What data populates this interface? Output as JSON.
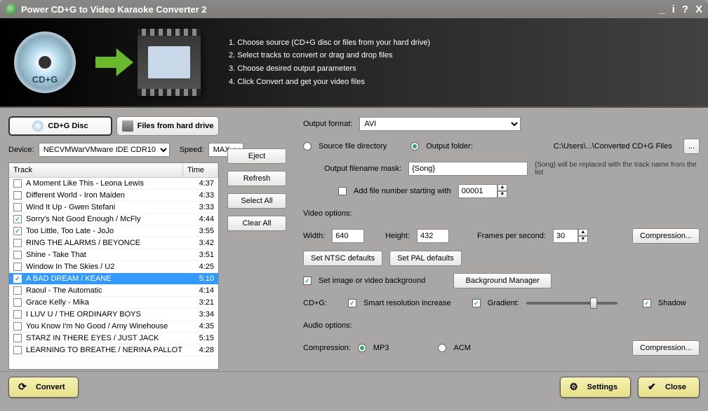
{
  "app": {
    "title": "Power CD+G to Video Karaoke Converter 2"
  },
  "banner": {
    "disc_label": "CD+G",
    "steps": [
      "1. Choose source (CD+G disc or files from your hard drive)",
      "2. Select tracks to convert or drag and drop files",
      "3. Choose desired output parameters",
      "4. Click Convert and get your video files"
    ]
  },
  "source": {
    "cdg_btn": "CD+G Disc",
    "files_btn": "Files from hard drive",
    "device_label": "Device:",
    "device_value": "NECVMWarVMware IDE CDR10",
    "speed_label": "Speed:",
    "speed_value": "MAX"
  },
  "track_header": {
    "track": "Track",
    "time": "Time"
  },
  "tracks": [
    {
      "name": "A Moment Like This - Leona Lewis",
      "time": "4:37",
      "checked": false,
      "selected": false
    },
    {
      "name": "Different World - Iron Maiden",
      "time": "4:33",
      "checked": false,
      "selected": false
    },
    {
      "name": "Wind It Up - Gwen Stefani",
      "time": "3:33",
      "checked": false,
      "selected": false
    },
    {
      "name": "Sorry's Not Good Enough / McFly",
      "time": "4:44",
      "checked": true,
      "selected": false
    },
    {
      "name": "Too Little, Too Late - JoJo",
      "time": "3:55",
      "checked": true,
      "selected": false
    },
    {
      "name": "RING THE ALARMS / BEYONCE",
      "time": "3:42",
      "checked": false,
      "selected": false
    },
    {
      "name": "Shine - Take That",
      "time": "3:51",
      "checked": false,
      "selected": false
    },
    {
      "name": "Window In The Skies / U2",
      "time": "4:25",
      "checked": false,
      "selected": false
    },
    {
      "name": "A BAD DREAM / KEANE",
      "time": "5:10",
      "checked": true,
      "selected": true
    },
    {
      "name": "Raoul - The Automatic",
      "time": "4:14",
      "checked": false,
      "selected": false
    },
    {
      "name": "Grace Kelly - Mika",
      "time": "3:21",
      "checked": false,
      "selected": false
    },
    {
      "name": "I LUV U / THE ORDINARY BOYS",
      "time": "3:34",
      "checked": false,
      "selected": false
    },
    {
      "name": "You Know I'm No Good / Amy Winehouse",
      "time": "4:35",
      "checked": false,
      "selected": false
    },
    {
      "name": "STARZ IN THERE EYES / JUST JACK",
      "time": "5:15",
      "checked": false,
      "selected": false
    },
    {
      "name": "LEARNING TO BREATHE / NERINA PALLOT",
      "time": "4:28",
      "checked": false,
      "selected": false
    }
  ],
  "mid_buttons": {
    "eject": "Eject",
    "refresh": "Refresh",
    "select_all": "Select All",
    "clear_all": "Clear All"
  },
  "output": {
    "format_label": "Output format:",
    "format_value": "AVI",
    "src_dir_radio": "Source file directory",
    "out_folder_radio": "Output folder:",
    "out_folder_path": "C:\\Users\\...\\Converted CD+G Files",
    "browse": "...",
    "mask_label": "Output filename mask:",
    "mask_value": "{Song}",
    "mask_hint": "{Song} will be replaced with the track name from the list",
    "add_num_label": "Add file number starting with",
    "add_num_value": "00001"
  },
  "video": {
    "section": "Video options:",
    "width_label": "Width:",
    "width": "640",
    "height_label": "Height:",
    "height": "432",
    "fps_label": "Frames per second:",
    "fps": "30",
    "compression": "Compression...",
    "ntsc": "Set NTSC defaults",
    "pal": "Set PAL defaults",
    "set_bg_label": "Set image or video background",
    "bg_manager": "Background Manager",
    "cdg_label": "CD+G:",
    "smart": "Smart resolution increase",
    "gradient": "Gradient:",
    "shadow": "Shadow"
  },
  "audio": {
    "section": "Audio options:",
    "compression_label": "Compression:",
    "mp3": "MP3",
    "acm": "ACM",
    "compression_btn": "Compression..."
  },
  "footer": {
    "convert": "Convert",
    "settings": "Settings",
    "close": "Close"
  }
}
